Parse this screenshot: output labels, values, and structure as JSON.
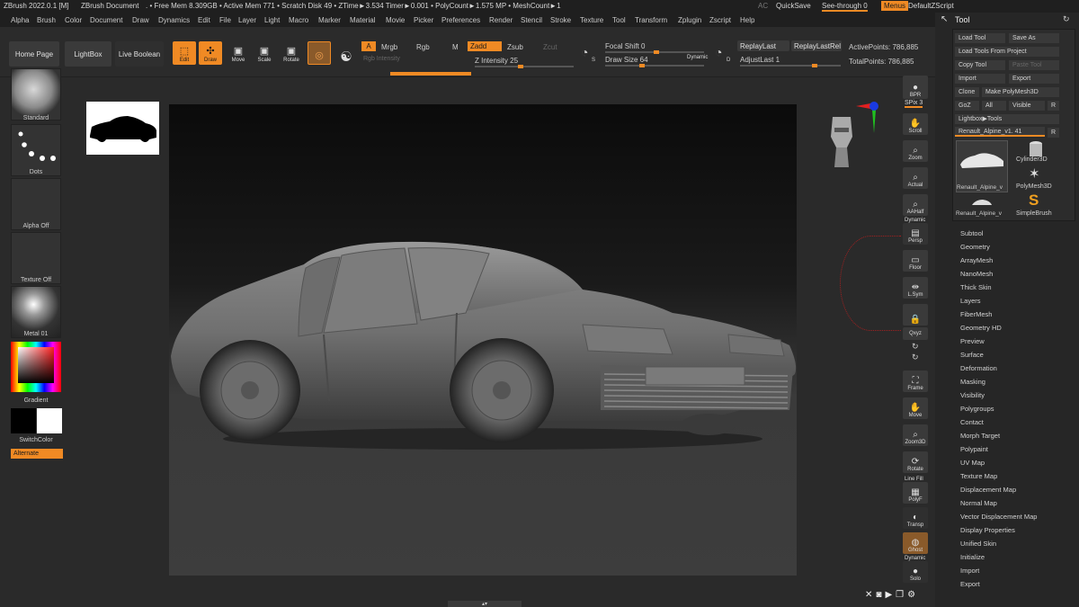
{
  "titlebar": {
    "app": "ZBrush 2022.0.1 [M]",
    "doc": "ZBrush Document",
    "stats": ". • Free Mem 8.309GB • Active Mem 771 • Scratch Disk 49 • ZTime►3.534 Timer►0.001 • PolyCount►1.575 MP • MeshCount►1",
    "ac": "AC",
    "quicksave": "QuickSave",
    "seethrough": "See-through  0",
    "menus": "Menus",
    "script": "DefaultZScript"
  },
  "menubar": [
    "Alpha",
    "Brush",
    "Color",
    "Document",
    "Draw",
    "Dynamics",
    "Edit",
    "File",
    "Layer",
    "Light",
    "Macro",
    "Marker",
    "Material",
    "Movie",
    "Picker",
    "Preferences",
    "Render",
    "Stencil",
    "Stroke",
    "Texture",
    "Tool",
    "Transform",
    "Zplugin",
    "Zscript",
    "Help"
  ],
  "toolbar": {
    "home": "Home Page",
    "lightbox": "LightBox",
    "liveboolean": "Live Boolean",
    "edit": "Edit",
    "draw": "Draw",
    "move": "Move",
    "scale": "Scale",
    "rotate": "Rotate",
    "a": "A",
    "mrgb": "Mrgb",
    "rgb": "Rgb",
    "m": "M",
    "zadd": "Zadd",
    "zsub": "Zsub",
    "zcut": "Zcut",
    "rgb_intensity": "Rgb Intensity",
    "z_intensity": "Z Intensity 25",
    "focal_shift": "Focal Shift 0",
    "draw_size": "Draw Size 64",
    "dynamic": "Dynamic",
    "replaylast": "ReplayLast",
    "replaylastrel": "ReplayLastRel",
    "adjustlast": "AdjustLast 1",
    "activepoints": "ActivePoints: 786,885",
    "totalpoints": "TotalPoints: 786,885",
    "s": "S",
    "d": "D"
  },
  "leftshelf": {
    "brush": "Standard",
    "stroke": "Dots",
    "alpha": "Alpha Off",
    "texture": "Texture Off",
    "material": "Metal 01",
    "gradient": "Gradient",
    "switchcolor": "SwitchColor",
    "alternate": "Alternate"
  },
  "rightshelf": {
    "bpr": "BPR",
    "spix": "SPix 3",
    "scroll": "Scroll",
    "zoom": "Zoom",
    "actual": "Actual",
    "aahalf": "AAHalf",
    "dynamic": "Dynamic",
    "persp": "Persp",
    "floor": "Floor",
    "lsym": "L.Sym",
    "lock": "",
    "xyz": "Qxyz",
    "frame": "Frame",
    "move": "Move",
    "zoom3d": "Zoom3D",
    "rotate": "Rotate",
    "linefill": "Line Fill",
    "polyf": "PolyF",
    "transp": "Transp",
    "ghost": "Ghost",
    "solo": "Solo",
    "dynamic2": "Dynamic"
  },
  "toolpanel": {
    "title": "Tool",
    "load": "Load Tool",
    "saveas": "Save As",
    "loadproject": "Load Tools From Project",
    "copy": "Copy Tool",
    "paste": "Paste Tool",
    "import": "Import",
    "export": "Export",
    "clone": "Clone",
    "makepoly": "Make PolyMesh3D",
    "goz": "GoZ",
    "all": "All",
    "visible": "Visible",
    "r": "R",
    "lightboxtools": "Lightbox▶Tools",
    "current": "Renault_Alpine_v1. 41",
    "thumbs": [
      "Renault_Alpine_v",
      "Cylinder3D",
      "PolyMesh3D",
      "Renault_Alpine_v",
      "SimpleBrush"
    ],
    "sections": [
      "Subtool",
      "Geometry",
      "ArrayMesh",
      "NanoMesh",
      "Thick Skin",
      "Layers",
      "FiberMesh",
      "Geometry HD",
      "Preview",
      "Surface",
      "Deformation",
      "Masking",
      "Visibility",
      "Polygroups",
      "Contact",
      "Morph Target",
      "Polypaint",
      "UV Map",
      "Texture Map",
      "Displacement Map",
      "Normal Map",
      "Vector Displacement Map",
      "Display Properties",
      "Unified Skin",
      "Initialize",
      "Import",
      "Export"
    ]
  },
  "colors": {
    "accent": "#f08a24",
    "bg": "#2a2a2a",
    "panel": "#262626"
  },
  "icons": [
    "close-icon",
    "gear-icon",
    "camera-icon",
    "video-icon",
    "layers-icon",
    "settings-icon"
  ]
}
